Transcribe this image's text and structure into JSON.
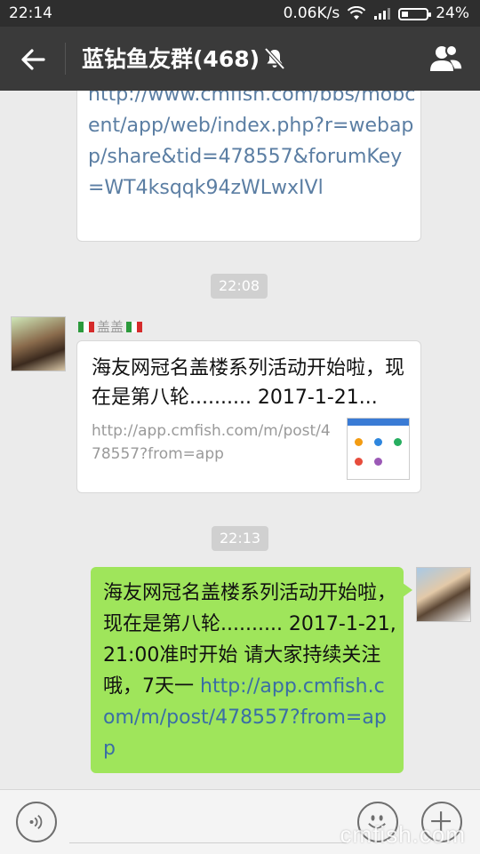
{
  "status_bar": {
    "time": "22:14",
    "net_speed": "0.06K/s",
    "battery": "24%"
  },
  "header": {
    "title": "蓝钻鱼友群(468)"
  },
  "messages": {
    "partial_link": "http://www.cmfish.com/bbs/mobcent/app/web/index.php?r=webapp/share&tid=478557&forumKey=WT4ksqqk94zWLwxIVl",
    "time1": "22:08",
    "sender_name": "盖盖",
    "share_title": "海友网冠名盖楼系列活动开始啦，现在是第八轮.......... 2017-1-21...",
    "share_url": "http://app.cmfish.com/m/post/478557?from=app",
    "time2": "22:13",
    "green_text": "海友网冠名盖楼系列活动开始啦，现在是第八轮.......... 2017-1-21, 21:00准时开始 请大家持续关注哦，7天一",
    "green_link": "http://app.cmfish.com/m/post/478557?from=app"
  },
  "input_bar": {
    "watermark": "cmfish.com"
  },
  "icons": [
    "back-arrow-icon",
    "mute-bell-icon",
    "group-members-icon",
    "voice-icon",
    "emoji-icon",
    "plus-icon",
    "wifi-icon",
    "signal-icon",
    "battery-icon"
  ],
  "colors": {
    "title_bar": "#3a3a3a",
    "status_bar": "#2e2e2e",
    "green_bubble": "#9fe55b",
    "link": "#5b7ea3"
  }
}
